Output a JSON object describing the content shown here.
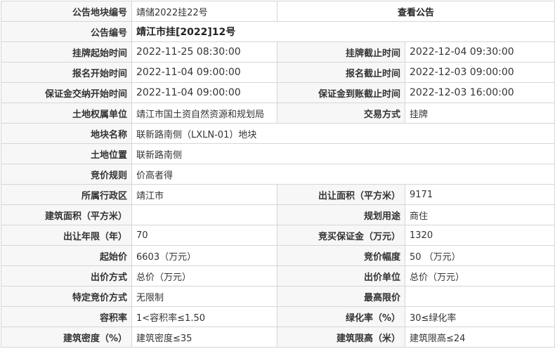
{
  "header": {
    "block_no_label": "公告地块编号",
    "block_no_value": "靖储2022挂22号",
    "view_notice_link": "查看公告",
    "notice_no_label": "公告编号",
    "notice_no_value": "靖江市挂[2022]12号"
  },
  "times": {
    "listing_start_label": "挂牌起始时间",
    "listing_start_value": "2022-11-25 08:30:00",
    "listing_end_label": "挂牌截止时间",
    "listing_end_value": "2022-12-04 09:30:00",
    "signup_start_label": "报名开始时间",
    "signup_start_value": "2022-11-04 09:00:00",
    "signup_end_label": "报名截止时间",
    "signup_end_value": "2022-12-03 09:00:00",
    "deposit_start_label": "保证金交纳开始时间",
    "deposit_start_value": "2022-11-04 09:00:00",
    "deposit_end_label": "保证金到账截止时间",
    "deposit_end_value": "2022-12-03 16:00:00"
  },
  "info": {
    "owner_label": "土地权属单位",
    "owner_value": "靖江市国土资自然资源和规划局",
    "trade_method_label": "交易方式",
    "trade_method_value": "挂牌",
    "block_name_label": "地块名称",
    "block_name_value": "联新路南侧（LXLN-01）地块",
    "location_label": "土地位置",
    "location_value": "联新路南侧",
    "bid_rule_label": "竞价规则",
    "bid_rule_value": "价高者得",
    "district_label": "所属行政区",
    "district_value": "靖江市",
    "transfer_area_label": "出让面积（平方米）",
    "transfer_area_value": "9171",
    "building_area_label": "建筑面积（平方米）",
    "building_area_value": "",
    "planned_use_label": "规划用途",
    "planned_use_value": "商住",
    "years_label": "出让年限（年）",
    "years_value": "70",
    "bid_deposit_label": "竞买保证金（万元）",
    "bid_deposit_value": "1320",
    "start_price_label": "起始价",
    "start_price_value": "6603（万元）",
    "increment_label": "竞价幅度",
    "increment_value": "50 （万元）",
    "price_method_label": "出价方式",
    "price_method_value": "总价（万元）",
    "price_unit_label": "出价单位",
    "price_unit_value": "总价（万元）",
    "special_bid_label": "特定竞价方式",
    "special_bid_value": "无限制",
    "max_price_label": "最高限价",
    "max_price_value": "",
    "plot_ratio_label": "容积率",
    "plot_ratio_value": "1<容积率≤1.50",
    "green_rate_label": "绿化率（%）",
    "green_rate_value": "30≤绿化率",
    "density_label": "建筑密度（%）",
    "density_value": "建筑密度≤35",
    "height_label": "建筑限高（米）",
    "height_value": "建筑限高≤24"
  }
}
